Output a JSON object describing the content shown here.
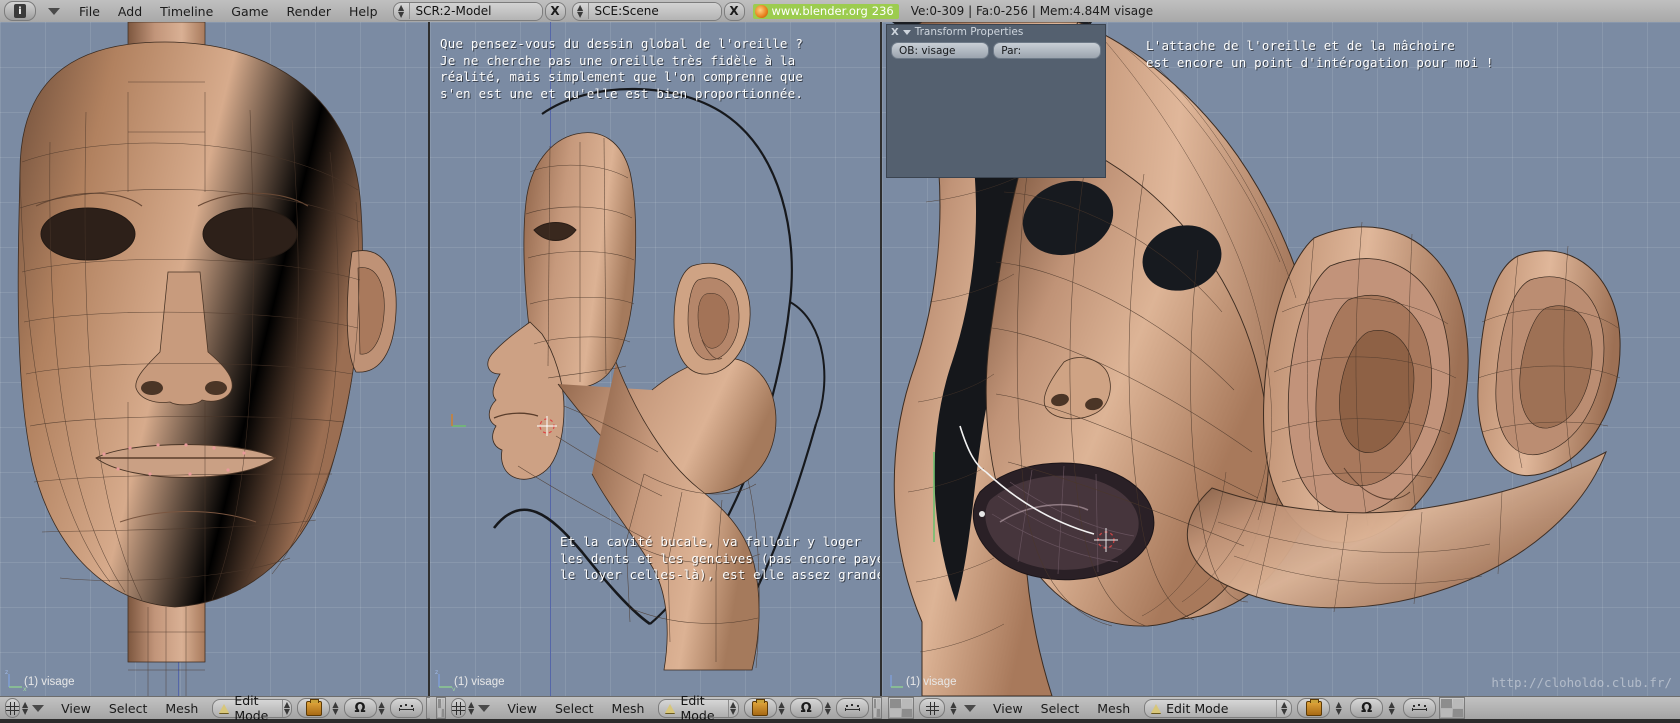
{
  "app": {
    "name": "Blender",
    "version_label": "236",
    "url_label": "www.blender.org",
    "stats": "Ve:0-309 | Fa:0-256 | Mem:4.84M visage"
  },
  "topbar": {
    "icon_name": "blender-logo-icon",
    "window_type_label": "window-type-menu",
    "menus": [
      "File",
      "Add",
      "Timeline",
      "Game",
      "Render",
      "Help"
    ],
    "screen_selector": {
      "value": "SCR:2-Model",
      "close_label": "X"
    },
    "scene_selector": {
      "value": "SCE:Scene",
      "close_label": "X"
    }
  },
  "viewports": [
    {
      "id": "front",
      "object_label": "(1) visage",
      "notes": []
    },
    {
      "id": "side",
      "object_label": "(1) visage",
      "notes": [
        {
          "position": "top",
          "text": "Que pensez-vous du dessin global de l'oreille ?\nJe ne cherche pas une oreille très fidèle à la\nréalité, mais simplement que l'on comprenne que\ns'en est une et qu'elle est bien proportionnée."
        },
        {
          "position": "bottom",
          "text": "Et la cavité bucale, va falloir y loger\nles dents et les gencives (pas encore payé\nle loyer celles-là), est elle assez grande ?"
        }
      ]
    },
    {
      "id": "perspective",
      "object_label": "(1) visage",
      "watermark": "http://cloholdo.club.fr/",
      "notes": [
        {
          "position": "top",
          "text": "L'attache de l'oreille et de la mâchoire\nest encore un point d'intérogation pour moi !"
        }
      ]
    }
  ],
  "transform_panel": {
    "title": "Transform Properties",
    "close_label": "X",
    "fields": [
      {
        "label": "OB: visage"
      },
      {
        "label": "Par:"
      }
    ]
  },
  "headers": [
    {
      "id": "header-front",
      "view_menu": "View",
      "select_menu": "Select",
      "mesh_menu": "Mesh",
      "mode": "Edit Mode",
      "draw_type_icon": "shading-pot-icon",
      "rotate_icon": "magnet-icon",
      "limit_icon": "dots-icon"
    },
    {
      "id": "header-side",
      "view_menu": "View",
      "select_menu": "Select",
      "mesh_menu": "Mesh",
      "mode": "Edit Mode",
      "draw_type_icon": "shading-pot-icon",
      "rotate_icon": "magnet-icon",
      "limit_icon": "dots-icon"
    },
    {
      "id": "header-persp",
      "view_menu": "View",
      "select_menu": "Select",
      "mesh_menu": "Mesh",
      "mode": "Edit Mode",
      "draw_type_icon": "shading-pot-icon",
      "rotate_icon": "magnet-icon",
      "limit_icon": "dots-icon"
    }
  ],
  "colors": {
    "viewport_bg": "#7b8ba3",
    "header_bg": "#b4b4b4",
    "mesh_skin": "#c79d80",
    "mesh_skin_dark": "#8a6249",
    "link_green": "#9ccc4f",
    "panel_bg": "#54606f"
  }
}
